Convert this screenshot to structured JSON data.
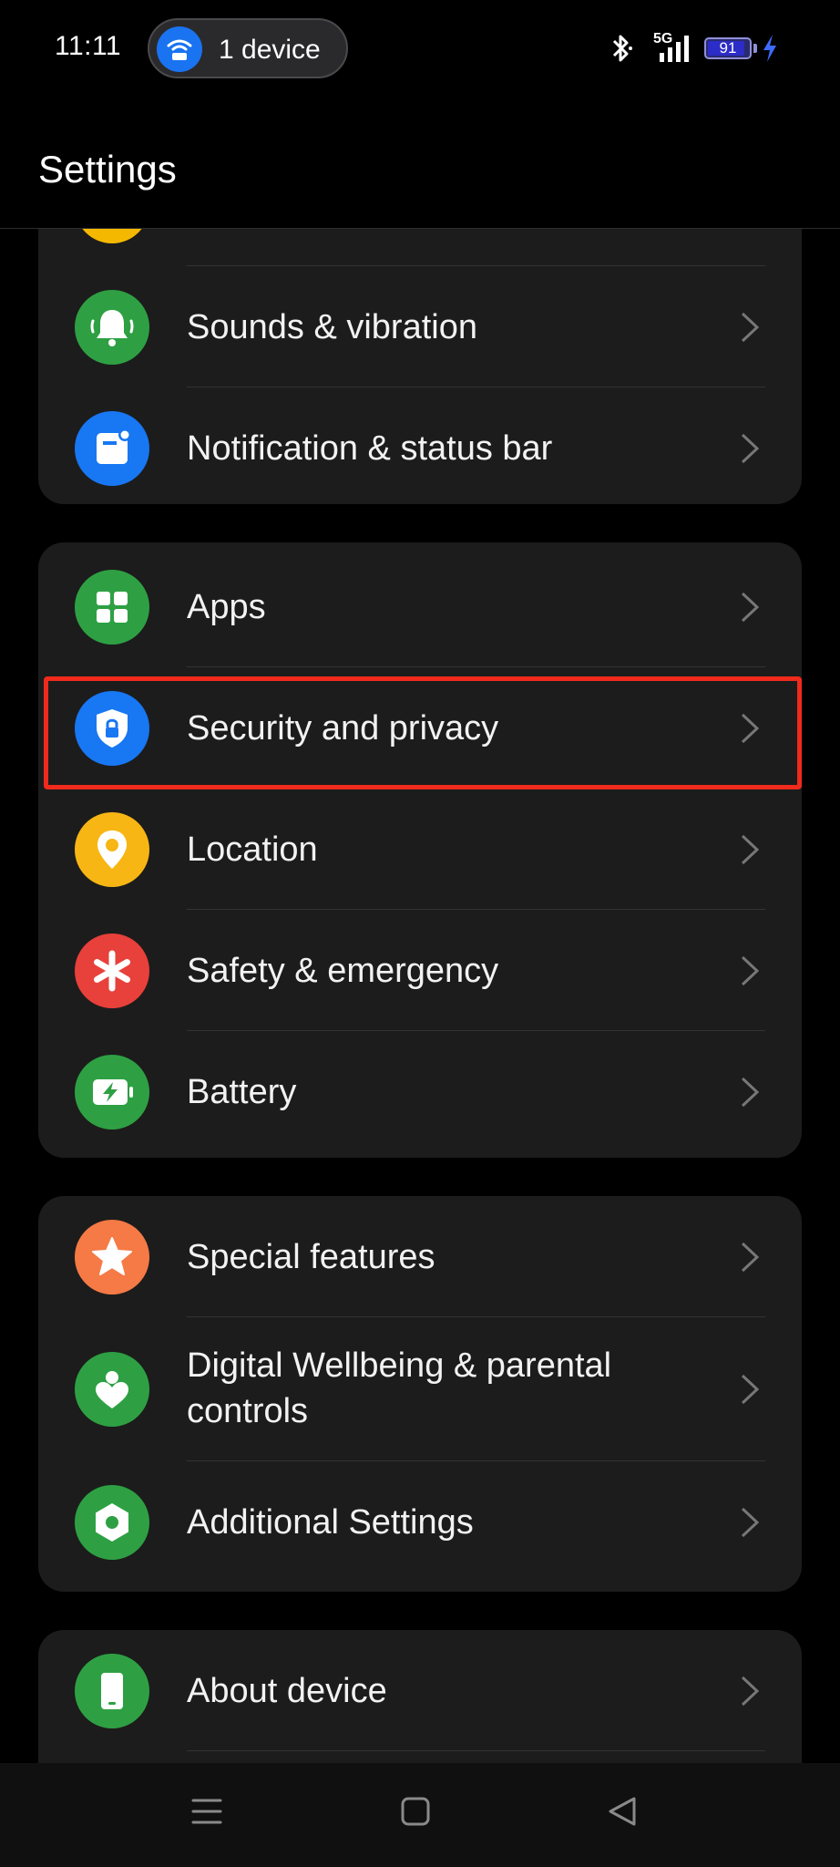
{
  "status_bar": {
    "time": "11:11",
    "hotspot_pill": {
      "label": "1 device",
      "icon": "hotspot-icon"
    },
    "network_label": "5G",
    "battery_level": "91",
    "battery_fraction": 0.91,
    "icons": [
      "bluetooth-icon",
      "signal-5g-icon",
      "battery-icon",
      "charging-bolt-icon"
    ],
    "colors": {
      "pill_icon": "#1a73f0",
      "battery": "#2c2cc8",
      "bolt": "#3d6bff"
    }
  },
  "header": {
    "title": "Settings"
  },
  "groups": [
    {
      "items": [
        {
          "label": "",
          "icon": "partial-yellow-icon",
          "color": "#f5b800"
        },
        {
          "label": "Sounds & vibration",
          "icon": "bell-icon",
          "color": "#2ea043"
        },
        {
          "label": "Notification & status bar",
          "icon": "notification-icon",
          "color": "#1877f2"
        }
      ]
    },
    {
      "items": [
        {
          "label": "Apps",
          "icon": "apps-grid-icon",
          "color": "#2ea043"
        },
        {
          "label": "Security and privacy",
          "icon": "shield-lock-icon",
          "color": "#1877f2",
          "highlighted": true
        },
        {
          "label": "Location",
          "icon": "location-pin-icon",
          "color": "#f7b614"
        },
        {
          "label": "Safety & emergency",
          "icon": "asterisk-icon",
          "color": "#e8403a"
        },
        {
          "label": "Battery",
          "icon": "battery-charging-icon",
          "color": "#2ea043"
        }
      ]
    },
    {
      "items": [
        {
          "label": "Special features",
          "icon": "star-icon",
          "color": "#f57a45"
        },
        {
          "label": "Digital Wellbeing & parental controls",
          "icon": "wellbeing-icon",
          "color": "#2ea043"
        },
        {
          "label": "Additional Settings",
          "icon": "gear-icon",
          "color": "#2ea043"
        }
      ]
    },
    {
      "items": [
        {
          "label": "About device",
          "icon": "phone-icon",
          "color": "#2ea043"
        }
      ]
    }
  ],
  "highlight_color": "#f02a1c",
  "nav_bar": {
    "buttons": [
      "menu-icon",
      "home-icon",
      "back-icon"
    ]
  }
}
